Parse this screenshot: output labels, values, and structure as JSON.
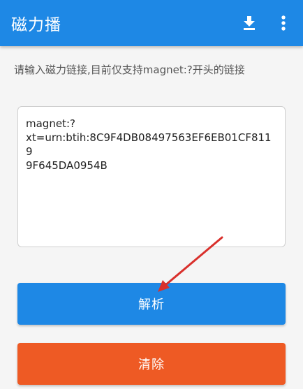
{
  "app_bar": {
    "title": "磁力播",
    "download_icon": "download-icon",
    "more_icon": "more-vert-icon",
    "color": "#1e88e5"
  },
  "hint": "请输入磁力链接,目前仅支持magnet:?开头的链接",
  "magnet_input": {
    "value": "magnet:?\nxt=urn:btih:8C9F4DB08497563EF6EB01CF8119\n9F645DA0954B"
  },
  "buttons": {
    "parse_label": "解析",
    "parse_color": "#1e88e5",
    "clear_label": "清除",
    "clear_color": "#ee5a24"
  },
  "annotation": {
    "arrow_color": "#d9302c"
  }
}
